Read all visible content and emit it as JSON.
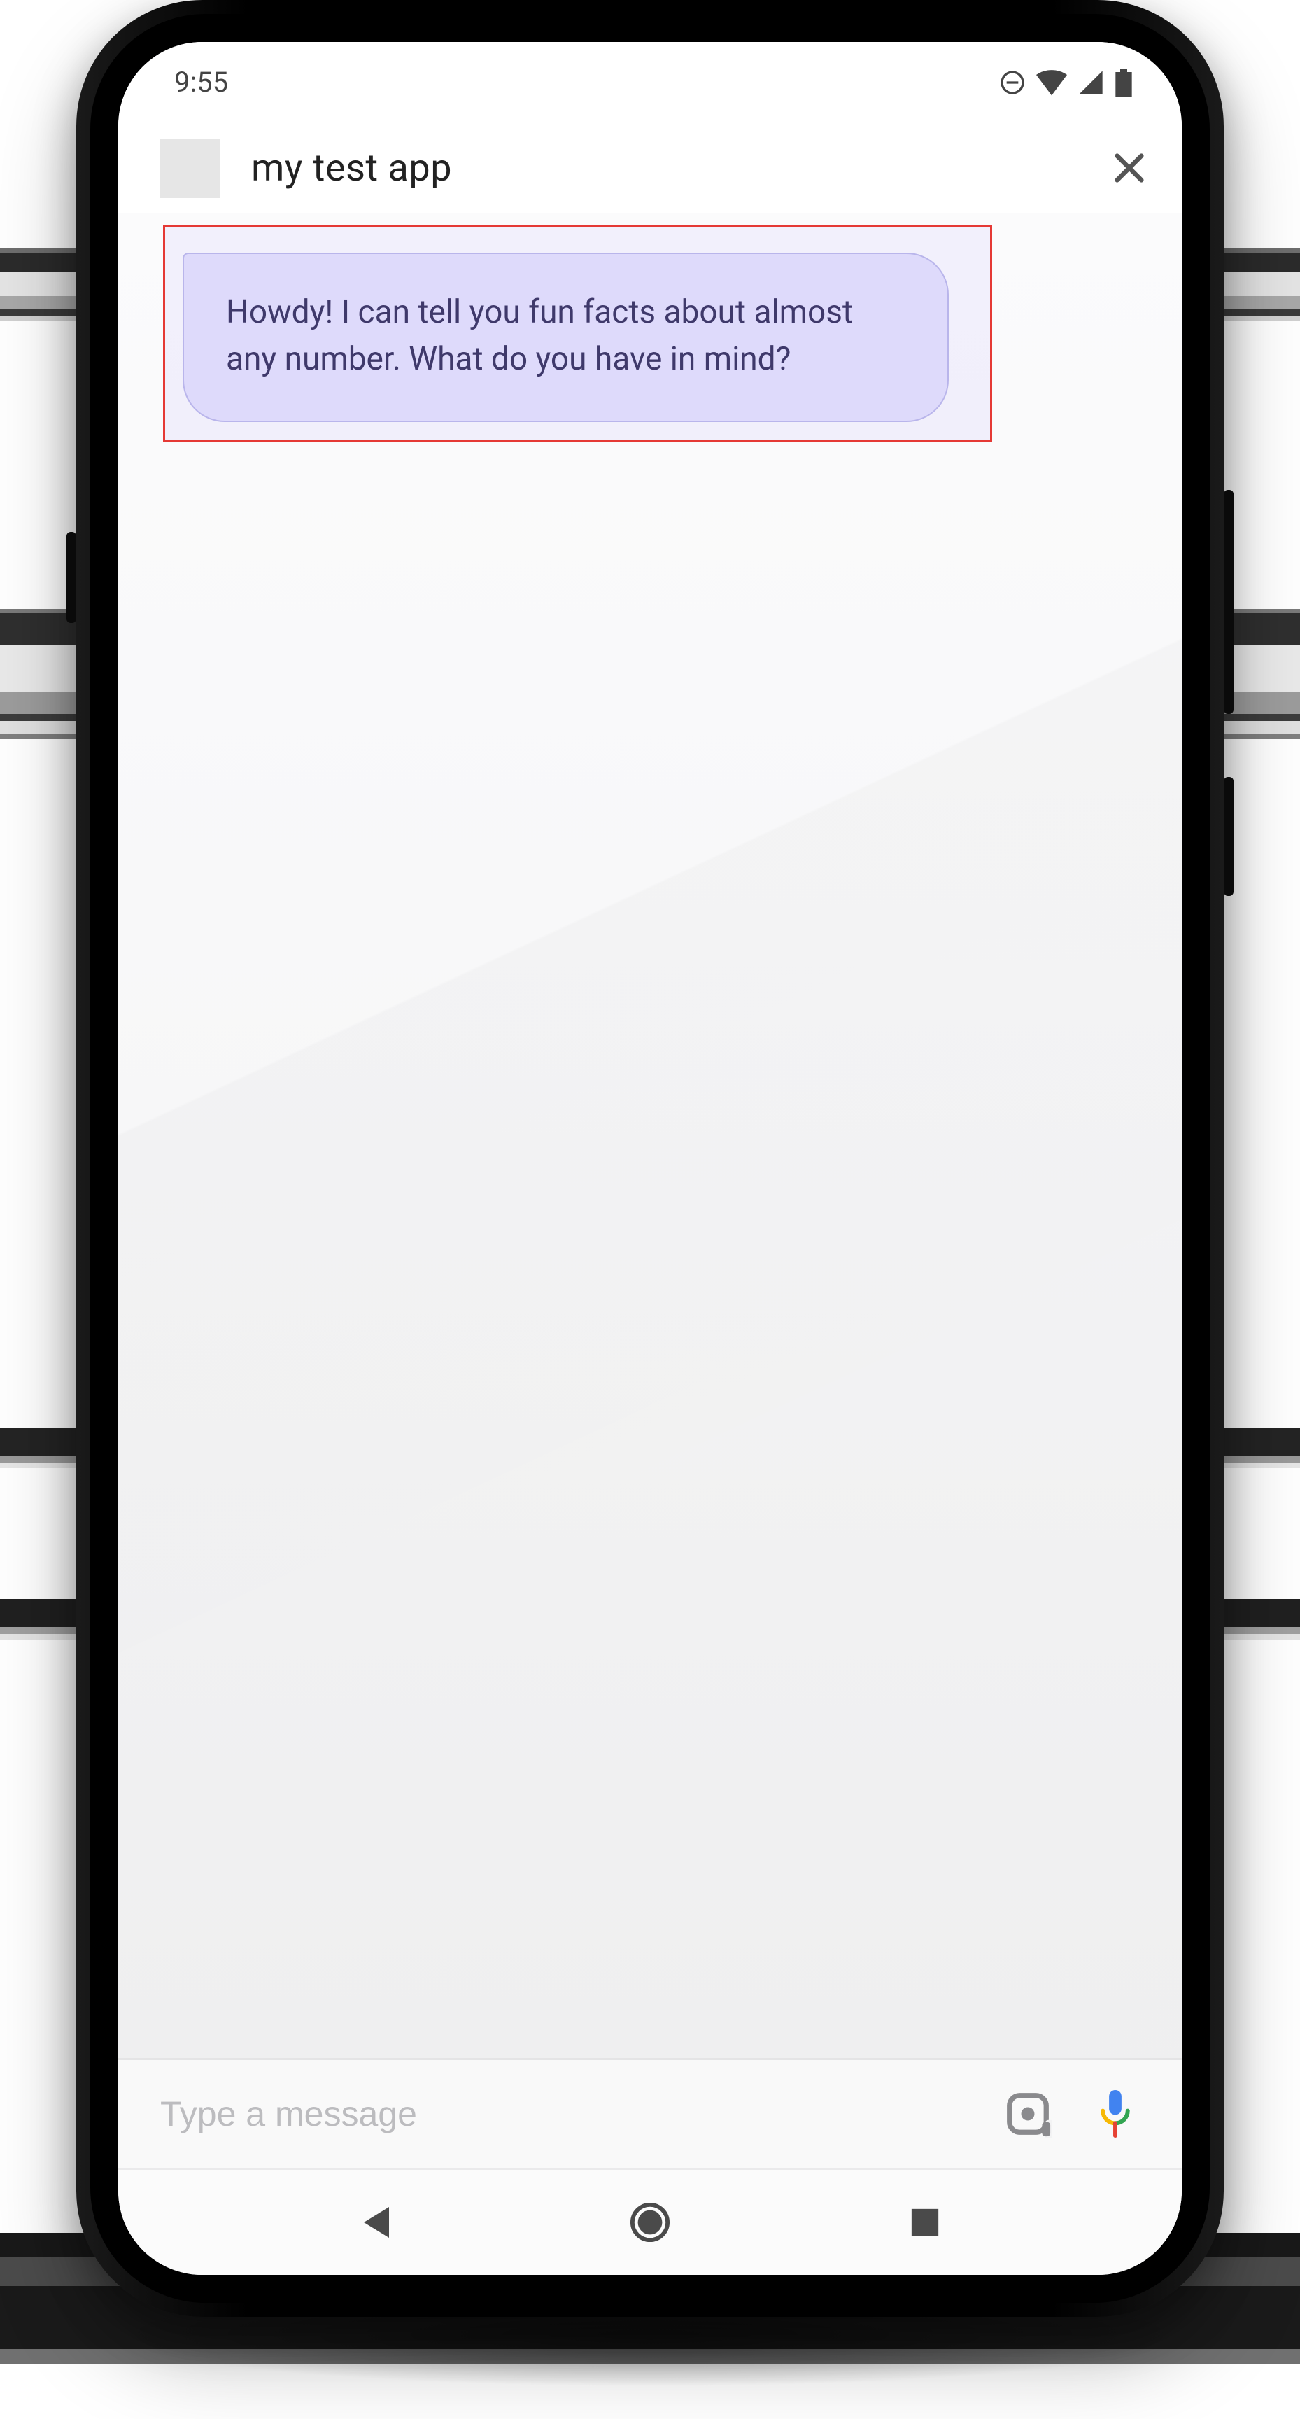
{
  "status": {
    "time": "9:55",
    "icons": {
      "dnd": "dnd-icon",
      "wifi": "wifi-icon",
      "signal": "signal-icon",
      "battery": "battery-icon"
    }
  },
  "header": {
    "title": "my test app",
    "close_label": "Close"
  },
  "chat": {
    "messages": [
      {
        "sender": "bot",
        "text": "Howdy! I can tell you fun facts about almost any number. What do you have in mind?"
      }
    ],
    "highlight_color": "#e53935",
    "bubble_color": "#e3e1fb"
  },
  "input": {
    "placeholder": "Type a message",
    "value": ""
  },
  "nav": {
    "back": "Back",
    "home": "Home",
    "recents": "Recents"
  }
}
